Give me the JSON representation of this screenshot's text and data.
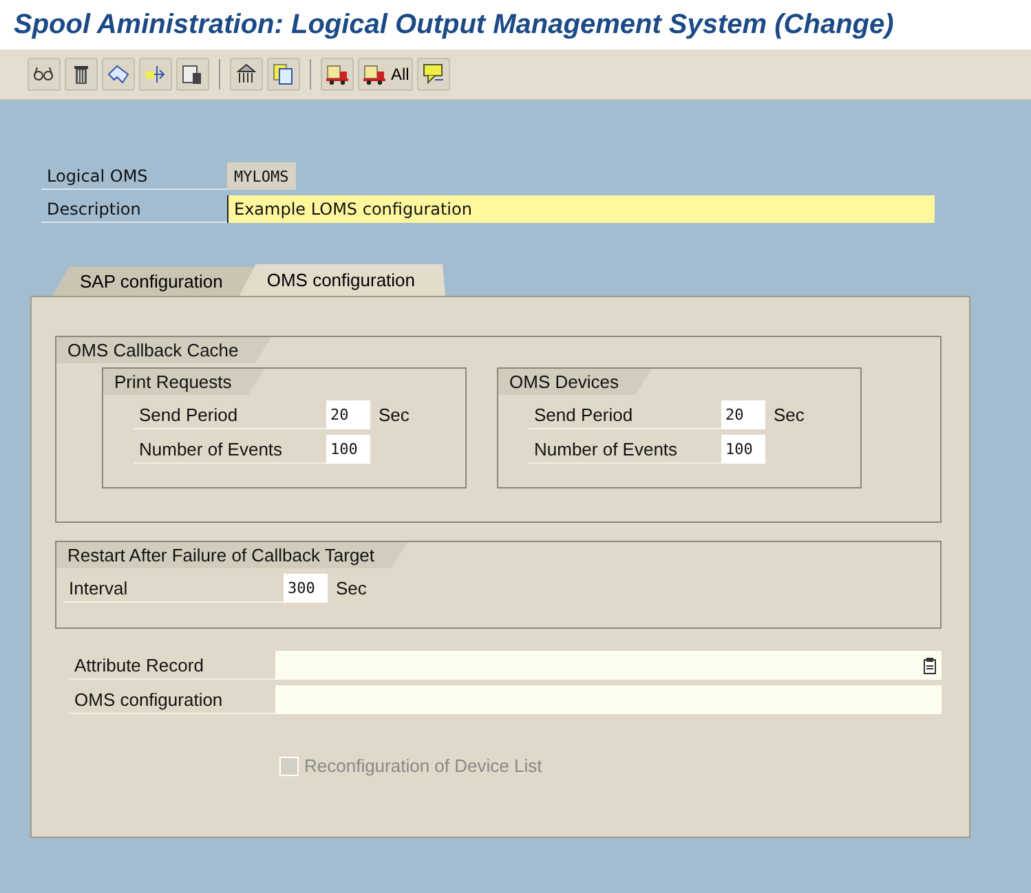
{
  "window": {
    "title": "Spool Aministration: Logical Output Management System (Change)"
  },
  "toolbar": {
    "all_label": "All"
  },
  "header_fields": [
    {
      "label": "Logical OMS",
      "value": "MYLOMS",
      "kind": "display"
    },
    {
      "label": "Description",
      "value": "Example LOMS configuration",
      "kind": "required"
    }
  ],
  "tabs": [
    {
      "label": "SAP configuration",
      "selected": false
    },
    {
      "label": "OMS configuration",
      "selected": true
    }
  ],
  "callback_cache": {
    "title": "OMS Callback Cache",
    "groups": [
      {
        "title": "Print Requests",
        "rows": [
          {
            "label": "Send Period",
            "value": "20",
            "unit": "Sec"
          },
          {
            "label": "Number of Events",
            "value": "100"
          }
        ]
      },
      {
        "title": "OMS Devices",
        "rows": [
          {
            "label": "Send Period",
            "value": "20",
            "unit": "Sec"
          },
          {
            "label": "Number of Events",
            "value": "100"
          }
        ]
      }
    ]
  },
  "restart": {
    "title": "Restart After Failure of Callback Target",
    "rows": [
      {
        "label": "Interval",
        "value": "300",
        "unit": "Sec"
      }
    ]
  },
  "fields": [
    {
      "label": "Attribute Record",
      "has_help": true
    },
    {
      "label": "OMS configuration",
      "has_help": false
    }
  ],
  "checkbox": {
    "label": "Reconfiguration of Device List",
    "checked": false,
    "disabled": true
  }
}
